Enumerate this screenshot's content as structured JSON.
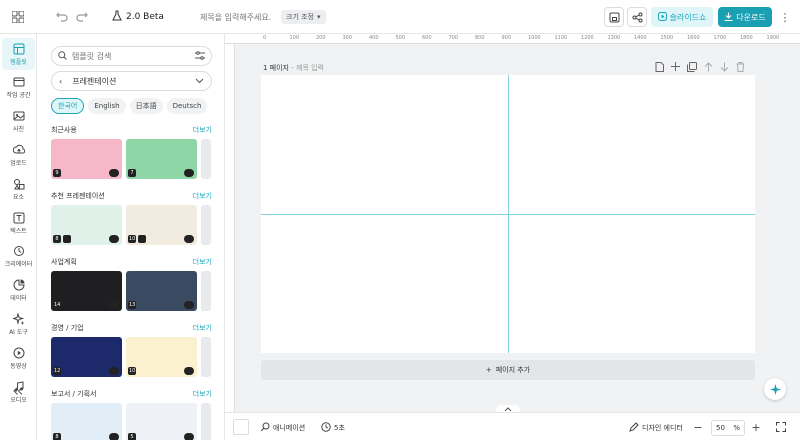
{
  "topbar": {
    "version": "2.0 Beta",
    "title_placeholder": "제목을 입력해주세요.",
    "size_label": "크기 조정",
    "slide_label": "슬라이드쇼",
    "download_label": "다운로드",
    "accent": "#1a9fb3"
  },
  "nav": {
    "items": [
      {
        "label": "템플릿",
        "icon": "template-icon",
        "active": true
      },
      {
        "label": "작업 공간",
        "icon": "workspace-icon"
      },
      {
        "label": "사진",
        "icon": "photo-icon"
      },
      {
        "label": "업로드",
        "icon": "upload-icon"
      },
      {
        "label": "요소",
        "icon": "elements-icon"
      },
      {
        "label": "텍스트",
        "icon": "text-icon"
      },
      {
        "label": "크리에이터",
        "icon": "creator-icon"
      },
      {
        "label": "데이터",
        "icon": "data-icon"
      },
      {
        "label": "AI 도구",
        "icon": "ai-tools-icon"
      },
      {
        "label": "동영상",
        "icon": "video-icon"
      },
      {
        "label": "오디오",
        "icon": "audio-icon"
      }
    ]
  },
  "panel": {
    "search_placeholder": "템플릿 검색",
    "category": "프레젠테이션",
    "languages": [
      "한국어",
      "English",
      "日本語",
      "Deutsch"
    ],
    "more_label": "더보기",
    "sections": [
      {
        "title": "최근사용",
        "thumbs": [
          {
            "count": "9",
            "color": "#f6b7c8"
          },
          {
            "count": "7",
            "color": "#8fd6a6"
          }
        ]
      },
      {
        "title": "추천 프레젠테이션",
        "thumbs": [
          {
            "count": "8",
            "color": "#dff1e8"
          },
          {
            "count": "10",
            "color": "#f1ecdf"
          }
        ]
      },
      {
        "title": "사업계획",
        "thumbs": [
          {
            "count": "14",
            "color": "#1f1f22"
          },
          {
            "count": "13",
            "color": "#3a4a60"
          }
        ]
      },
      {
        "title": "경영 / 기업",
        "thumbs": [
          {
            "count": "12",
            "color": "#1c2a6b"
          },
          {
            "count": "10",
            "color": "#fbf1cf"
          }
        ]
      },
      {
        "title": "보고서 / 기획서",
        "thumbs": [
          {
            "count": "8",
            "color": "#e2eef7"
          },
          {
            "count": "5",
            "color": "#eef1f6"
          }
        ]
      }
    ]
  },
  "ruler": {
    "labels": [
      "0",
      "100",
      "200",
      "300",
      "400",
      "500",
      "600",
      "700",
      "800",
      "900",
      "1000",
      "1100",
      "1200",
      "1300",
      "1400",
      "1500",
      "1600",
      "1700",
      "1800",
      "1900"
    ]
  },
  "canvas": {
    "page_label": "1 페이지",
    "page_title_placeholder": "제목 입력",
    "add_page": "페이지 추가"
  },
  "bottombar": {
    "animation": "애니메이션",
    "duration": "5초",
    "design_editor": "디자인 에디터",
    "zoom": "50",
    "zoom_unit": "%"
  }
}
